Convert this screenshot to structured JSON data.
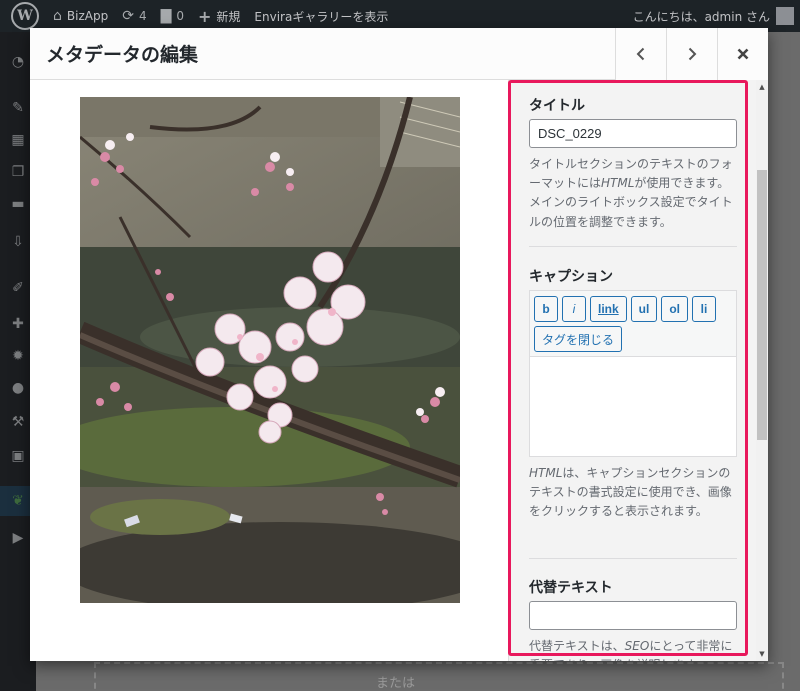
{
  "adminbar": {
    "site_name": "BizApp",
    "updates_count": "4",
    "comments_count": "0",
    "new_label": "新規",
    "gallery_link": "Enviraギャラリーを表示",
    "greeting": "こんにちは、admin さん"
  },
  "page": {
    "or_text": "または"
  },
  "modal": {
    "title": "メタデータの編集",
    "prev_icon": "chevron-left-icon",
    "next_icon": "chevron-right-icon",
    "close_icon": "close-icon"
  },
  "photo": {
    "icon": "cherry-blossom-photo"
  },
  "settings": {
    "title_label": "タイトル",
    "title_value": "DSC_0229",
    "title_help_1": "タイトルセクションのテキストのフォーマットには",
    "title_help_em": "HTML",
    "title_help_2": "が使用できます。メインのライトボックス設定でタイトルの位置を調整できます。",
    "caption_label": "キャプション",
    "toolbar": {
      "b": "b",
      "i": "i",
      "link": "link",
      "ul": "ul",
      "ol": "ol",
      "li": "li",
      "close_tags": "タグを閉じる"
    },
    "caption_value": "",
    "caption_help_em": "HTML",
    "caption_help": "は、キャプションセクションのテキストの書式設定に使用でき、画像をクリックすると表示されます。",
    "alt_label": "代替テキスト",
    "alt_value": "",
    "alt_help_1": "代替テキストは、",
    "alt_help_em": "SEO",
    "alt_help_2": "にとって非常に重要であり、画像を説明します。"
  },
  "colors": {
    "highlight": "#e8185c",
    "accent": "#2271b1",
    "adminbar": "#1d2327"
  }
}
